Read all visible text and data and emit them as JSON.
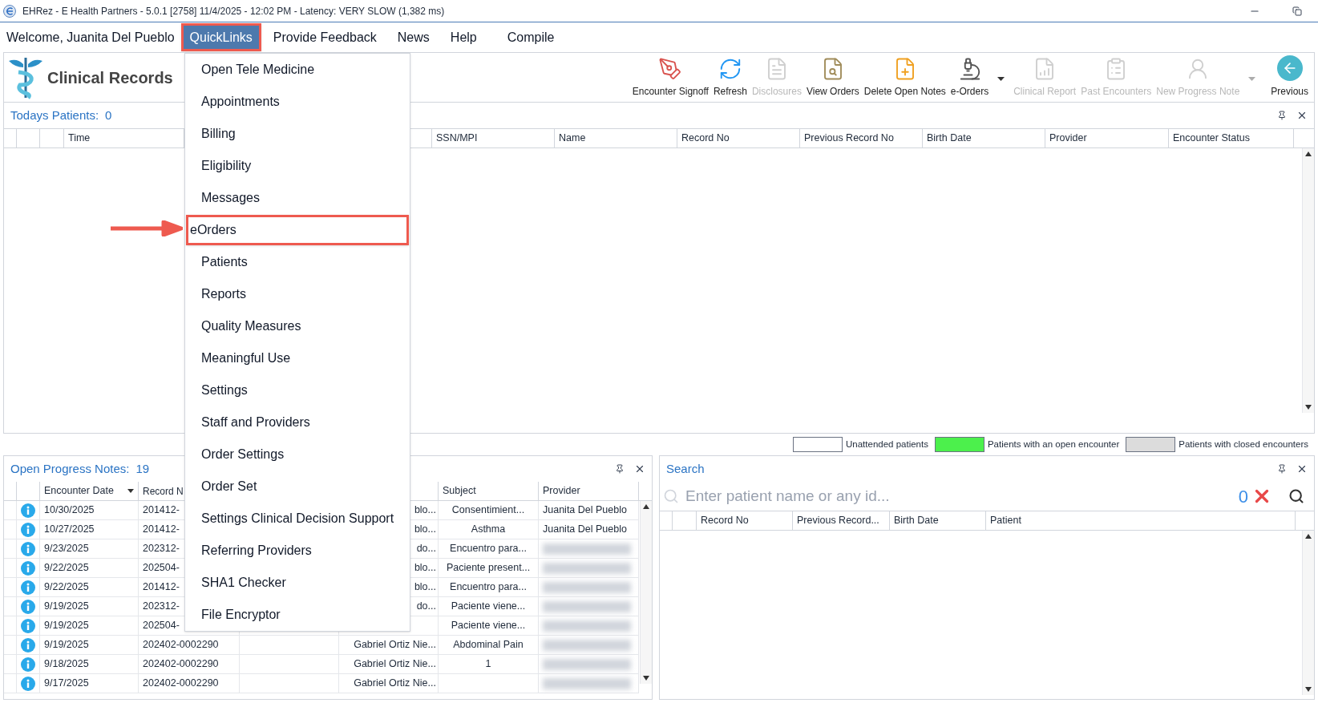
{
  "window": {
    "title": "EHRez - E Health Partners - 5.0.1 [2758] 11/4/2025 - 12:02 PM - Latency: VERY SLOW (1,382 ms)"
  },
  "menu_bar": {
    "welcome": "Welcome, Juanita Del Pueblo",
    "items": [
      {
        "label": "QuickLinks",
        "selected": true,
        "highlighted": true
      },
      {
        "label": "Provide Feedback",
        "selected": false,
        "highlighted": false
      },
      {
        "label": "News",
        "selected": false,
        "highlighted": false
      },
      {
        "label": "Help",
        "selected": false,
        "highlighted": false
      },
      {
        "label": "Compile",
        "selected": false,
        "highlighted": false
      }
    ]
  },
  "app_title": "Clinical Records",
  "toolbar": [
    {
      "label": "Encounter Signoff",
      "disabled": false,
      "has_menu": false
    },
    {
      "label": "Refresh",
      "disabled": false,
      "has_menu": false
    },
    {
      "label": "Disclosures",
      "disabled": true,
      "has_menu": false
    },
    {
      "label": "View Orders",
      "disabled": false,
      "has_menu": false
    },
    {
      "label": "Delete Open Notes",
      "disabled": false,
      "has_menu": false
    },
    {
      "label": "e-Orders",
      "disabled": false,
      "has_menu": true
    },
    {
      "label": "Clinical Report",
      "disabled": true,
      "has_menu": false
    },
    {
      "label": "Past Encounters",
      "disabled": true,
      "has_menu": false
    },
    {
      "label": "New Progress Note",
      "disabled": true,
      "has_menu": true
    },
    {
      "label": "Previous",
      "disabled": false,
      "has_menu": false
    }
  ],
  "todays_patients": {
    "title": "Todays Patients:",
    "count": "0",
    "columns": [
      "Time",
      "SSN/MPI",
      "Name",
      "Record No",
      "Previous Record No",
      "Birth Date",
      "Provider",
      "Encounter Status"
    ]
  },
  "legend": [
    {
      "label": "Unattended patients",
      "color": "#ffffff"
    },
    {
      "label": "Patients with an open encounter",
      "color": "#4cf04c"
    },
    {
      "label": "Patients with closed encounters",
      "color": "#dcdcdc"
    }
  ],
  "progress_notes": {
    "title": "Open Progress Notes:",
    "count": "19",
    "columns": [
      "Encounter Date",
      "Record N",
      "Subject",
      "Provider"
    ],
    "rows": [
      {
        "date": "10/30/2025",
        "record": "201412-",
        "column_6": "blo...",
        "subject": "Consentimient...",
        "provider": "Juanita Del Pueblo",
        "provider_blurred": false
      },
      {
        "date": "10/27/2025",
        "record": "201412-",
        "column_6": "blo...",
        "subject": "Asthma",
        "provider": "Juanita Del Pueblo",
        "provider_blurred": false
      },
      {
        "date": "9/23/2025",
        "record": "202312-",
        "column_6": "do...",
        "subject": "Encuentro para...",
        "provider_blurred": true
      },
      {
        "date": "9/22/2025",
        "record": "202504-",
        "column_6": "blo...",
        "subject": "Paciente present...",
        "provider_blurred": true
      },
      {
        "date": "9/22/2025",
        "record": "201412-",
        "column_6": "blo...",
        "subject": "Encuentro para...",
        "provider_blurred": true
      },
      {
        "date": "9/19/2025",
        "record": "202312-",
        "column_6": "do...",
        "subject": "Paciente viene...",
        "provider_blurred": true
      },
      {
        "date": "9/19/2025",
        "record": "202504-",
        "subject": "Paciente viene...",
        "provider_blurred": true
      },
      {
        "date": "9/19/2025",
        "record": "202402-0002290",
        "column_6": "Gabriel Ortiz Nie...",
        "subject": "Abdominal Pain",
        "provider_blurred": true
      },
      {
        "date": "9/18/2025",
        "record": "202402-0002290",
        "column_6": "Gabriel Ortiz Nie...",
        "subject": "1",
        "provider_blurred": true
      },
      {
        "date": "9/17/2025",
        "record": "202402-0002290",
        "column_6": "Gabriel Ortiz Nie...",
        "provider_blurred": true
      }
    ]
  },
  "search": {
    "title": "Search",
    "placeholder": "Enter patient name or any id...",
    "count": "0",
    "columns": [
      "Record No",
      "Previous Record...",
      "Birth Date",
      "Patient"
    ]
  },
  "quicklinks_menu": [
    {
      "label": "Open Tele Medicine",
      "highlighted": false
    },
    {
      "label": "Appointments",
      "highlighted": false
    },
    {
      "label": "Billing",
      "highlighted": false
    },
    {
      "label": "Eligibility",
      "highlighted": false
    },
    {
      "label": "Messages",
      "highlighted": false
    },
    {
      "label": "eOrders",
      "highlighted": true
    },
    {
      "label": "Patients",
      "highlighted": false
    },
    {
      "label": "Reports",
      "highlighted": false
    },
    {
      "label": "Quality Measures",
      "highlighted": false
    },
    {
      "label": "Meaningful Use",
      "highlighted": false
    },
    {
      "label": "Settings",
      "highlighted": false
    },
    {
      "label": "Staff and Providers",
      "highlighted": false
    },
    {
      "label": "Order Settings",
      "highlighted": false
    },
    {
      "label": "Order Set",
      "highlighted": false
    },
    {
      "label": "Settings Clinical Decision Support",
      "highlighted": false
    },
    {
      "label": "Referring Providers",
      "highlighted": false
    },
    {
      "label": "SHA1 Checker",
      "highlighted": false
    },
    {
      "label": "File Encryptor",
      "highlighted": false
    }
  ]
}
